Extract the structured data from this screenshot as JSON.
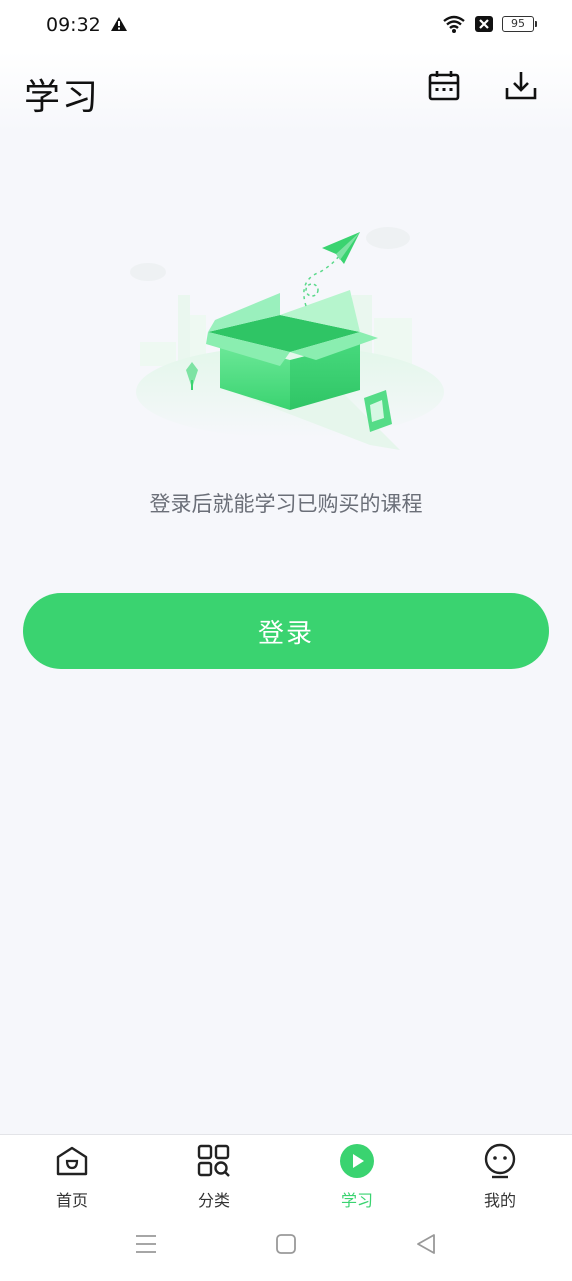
{
  "status": {
    "time": "09:32",
    "battery": "95"
  },
  "header": {
    "title": "学习"
  },
  "empty": {
    "message": "登录后就能学习已购买的课程"
  },
  "login": {
    "label": "登录"
  },
  "tabs": [
    {
      "label": "首页",
      "icon": "home-icon"
    },
    {
      "label": "分类",
      "icon": "category-search-icon"
    },
    {
      "label": "学习",
      "icon": "play-icon",
      "active": true
    },
    {
      "label": "我的",
      "icon": "profile-face-icon"
    }
  ],
  "colors": {
    "accent": "#3ad370",
    "background": "#f6f7fb",
    "hint": "#6b6f78"
  }
}
